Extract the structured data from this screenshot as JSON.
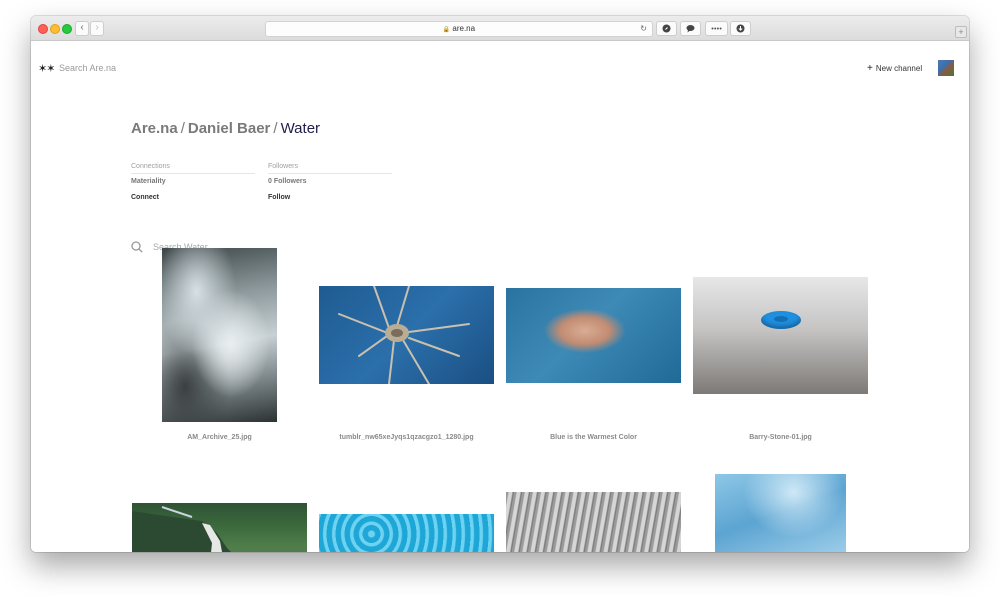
{
  "browser": {
    "url": "are.na",
    "back_icon": "chevron-left-icon",
    "forward_icon": "chevron-right-icon"
  },
  "header": {
    "logo": "✶✶",
    "search_placeholder": "Search Are.na",
    "new_channel_label": "New channel",
    "plus": "+"
  },
  "breadcrumb": {
    "root": "Are.na",
    "separator": "/",
    "user": "Daniel Baer",
    "channel": "Water"
  },
  "meta": {
    "connections_label": "Connections",
    "connections_value": "Materiality",
    "connect_label": "Connect",
    "followers_label": "Followers",
    "followers_value": "0 Followers",
    "follow_label": "Follow"
  },
  "channel_search": {
    "placeholder": "Search Water"
  },
  "blocks": [
    {
      "title": "AM_Archive_25.jpg"
    },
    {
      "title": "tumblr_nw65xeJyqs1qzacgzo1_1280.jpg"
    },
    {
      "title": "Blue is the Warmest Color"
    },
    {
      "title": "Barry-Stone-01.jpg"
    }
  ]
}
